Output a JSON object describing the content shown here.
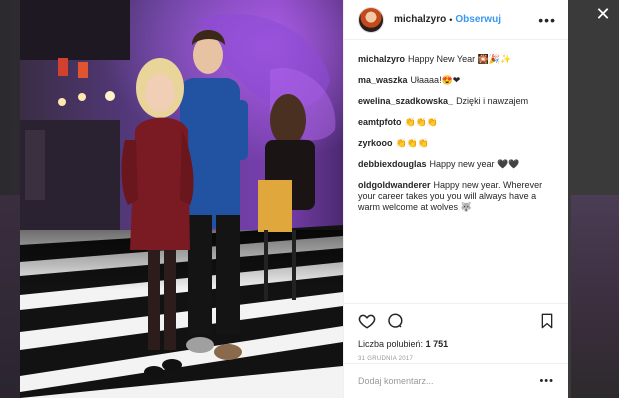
{
  "close_icon": "close-icon",
  "post": {
    "username": "michalzyro",
    "follow_label": "Obserwuj",
    "separator": "•",
    "more_icon": "more-horizontal-icon"
  },
  "comments": [
    {
      "author": "michalzyro",
      "text": "Happy New Year 🎇🎉✨"
    },
    {
      "author": "ma_waszka",
      "text": "Ułaaaa!😍❤"
    },
    {
      "author": "ewelina_szadkowska_",
      "text": "Dzięki i nawzajem"
    },
    {
      "author": "eamtpfoto",
      "text": "👏👏👏"
    },
    {
      "author": "zyrkooo",
      "text": "👏👏👏"
    },
    {
      "author": "debbiexdouglas",
      "text": "Happy new year 🖤🖤"
    },
    {
      "author": "oldgoldwanderer",
      "text": "Happy new year. Wherever your career takes you you will always have a warm welcome at wolves 🐺"
    }
  ],
  "actions": {
    "like_icon": "heart-icon",
    "comment_icon": "comment-icon",
    "save_icon": "bookmark-icon",
    "likes_label": "Liczba polubień:",
    "likes_count": "1 751",
    "date": "31 GRUDNIA 2017"
  },
  "comment_box": {
    "placeholder": "Dodaj komentarz...",
    "options_icon": "more-horizontal-icon"
  },
  "colors": {
    "link": "#3897f0",
    "text": "#262626",
    "muted": "#999999",
    "border": "#efefef"
  }
}
